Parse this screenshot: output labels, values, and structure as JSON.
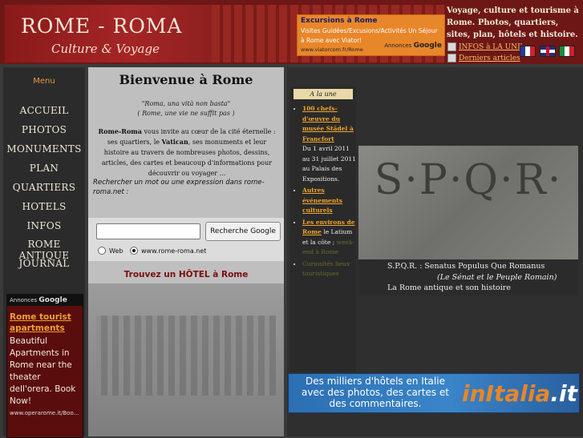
{
  "header": {
    "logo_title": "ROME - ROMA",
    "logo_subtitle": "Culture & Voyage",
    "tagline": "Voyage, culture et tourisme à Rome. Photos, quartiers, sites, plan, hôtels et histoire.",
    "link_infos": "INFOS à LA UNE",
    "link_articles": "Derniers articles",
    "ad": {
      "title": "Excursions à Rome",
      "text": "Visites Guidées/Excusions/Activités Un Séjour à Rome avec Viator!",
      "url": "www.viatorcom.fr/Rome",
      "label": "Annonces",
      "brand": "Google"
    }
  },
  "menu": {
    "title": "Menu",
    "items": [
      "ACCUEIL",
      "PHOTOS",
      "MONUMENTS",
      "PLAN",
      "QUARTIERS",
      "HOTELS",
      "INFOS",
      "ROME ANTIQUE",
      "JOURNAL"
    ]
  },
  "left_ad": {
    "label": "Annonces",
    "brand": "Google",
    "title": "Rome tourist apartments",
    "text": "Beautiful Apartments in Rome near the theater dell'orera. Book Now!",
    "url": "www.operarome.it/Boo..."
  },
  "center": {
    "title": "Bienvenue à Rome",
    "quote1": "\"Roma, una vità non basta\"",
    "quote2": "( Rome, une vie ne suffit pas )",
    "body_strong": "Rome-Roma",
    "body_1": " vous invite au cœur de la cité éternelle : ses quartiers, le ",
    "body_vatican": "Vatican",
    "body_2": ", ses monuments et leur histoire au travers de nombreuses photos, dessins, articles, des cartes et beaucoup d'informations pour découvrir ou voyager ...",
    "search_label": "Rechercher un mot ou une expression dans rome-roma.net :",
    "search_button": "Recherche Google",
    "search_value": "",
    "radio_web": "Web",
    "radio_site": "www.rome-roma.net",
    "hotel_link": "Trouvez un HÔTEL à Rome"
  },
  "news": {
    "header": "A la une",
    "item1_link": "100 chefs-d'œuvre du musée Städel à Francfort",
    "item1_text": "Du 1 avril 2011 au 31 juillet 2011 au Palais des Expositions.",
    "item2_link": "Autres événements culturels",
    "item3_link": "Les environs de Rome",
    "item3_text": " le Latium et la côte ; ",
    "item3_faded": "week-end à Rome",
    "item4_faded": "Curiosités lieux touristiques"
  },
  "spqr": {
    "image_text": "S·P·Q·R·",
    "caption1": "S.P.Q.R. : Senatus Populus Que Romanus",
    "caption2": "(Le Sénat et le Peuple Romain)",
    "caption3": "La Rome antique et son histoire"
  },
  "banner": {
    "text": "Des milliers d'hôtels en Italie avec des photos, des cartes et des commentaires.",
    "logo_main": "inItalia",
    "logo_ext": ".it"
  },
  "colors": {
    "header_red": "#6e1717",
    "accent_orange": "#e8862a",
    "link_orange": "#f0a52a",
    "menu_text": "#f0e8d8"
  }
}
